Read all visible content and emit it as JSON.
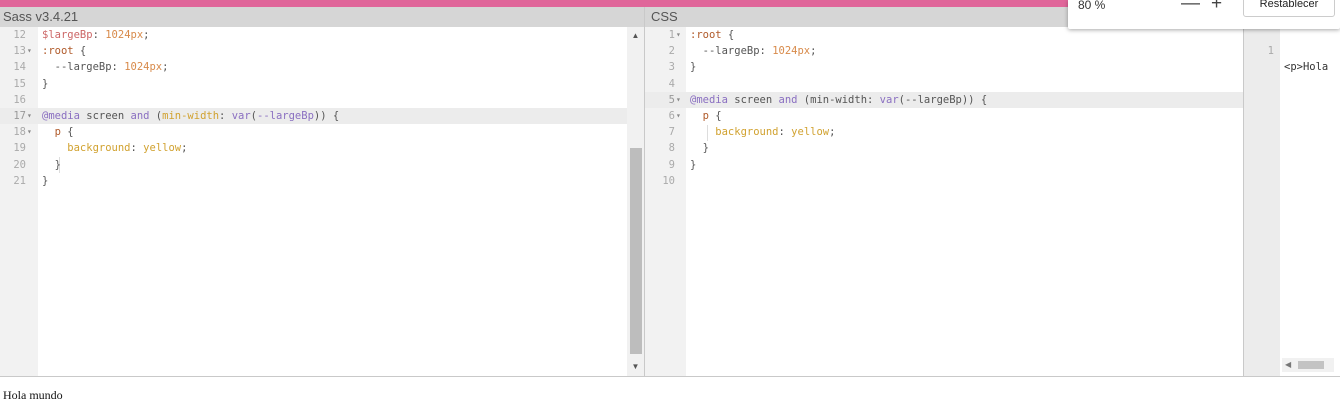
{
  "headers": {
    "sass": "Sass v3.4.21",
    "css": "CSS"
  },
  "sass_lines": [
    {
      "n": "12",
      "fold": false,
      "tokens": [
        [
          "t-var",
          "$largeBp"
        ],
        [
          "t-prop",
          ": "
        ],
        [
          "t-num",
          "1024px"
        ],
        [
          "t-prop",
          ";"
        ]
      ]
    },
    {
      "n": "13",
      "fold": true,
      "tokens": [
        [
          "t-sel",
          ":root"
        ],
        [
          "t-brace",
          " {"
        ]
      ]
    },
    {
      "n": "14",
      "fold": false,
      "tokens": [
        [
          "t-prop",
          "  --largeBp"
        ],
        [
          "t-prop",
          ": "
        ],
        [
          "t-num",
          "1024px"
        ],
        [
          "t-prop",
          ";"
        ]
      ]
    },
    {
      "n": "15",
      "fold": false,
      "tokens": [
        [
          "t-brace",
          "}"
        ]
      ]
    },
    {
      "n": "16",
      "fold": false,
      "tokens": []
    },
    {
      "n": "17",
      "fold": true,
      "active": true,
      "tokens": [
        [
          "t-kw",
          "@media"
        ],
        [
          "t-prop",
          " screen "
        ],
        [
          "t-kw",
          "and"
        ],
        [
          "t-prop",
          " ("
        ],
        [
          "t-val",
          "min-width"
        ],
        [
          "t-prop",
          ": "
        ],
        [
          "t-kw",
          "var"
        ],
        [
          "t-prop",
          "("
        ],
        [
          "t-kw",
          "--largeBp"
        ],
        [
          "t-prop",
          ")) {"
        ]
      ]
    },
    {
      "n": "18",
      "fold": true,
      "tokens": [
        [
          "t-sel",
          "  p"
        ],
        [
          "t-brace",
          " {"
        ]
      ]
    },
    {
      "n": "19",
      "fold": false,
      "tokens": [
        [
          "t-val",
          "    background"
        ],
        [
          "t-prop",
          ": "
        ],
        [
          "t-val",
          "yellow"
        ],
        [
          "t-prop",
          ";"
        ]
      ]
    },
    {
      "n": "20",
      "fold": false,
      "tokens": [
        [
          "t-brace",
          "  }"
        ]
      ]
    },
    {
      "n": "21",
      "fold": false,
      "tokens": [
        [
          "t-brace",
          "}"
        ]
      ]
    }
  ],
  "css_lines": [
    {
      "n": "1",
      "fold": true,
      "tokens": [
        [
          "t-sel",
          ":root"
        ],
        [
          "t-brace",
          " {"
        ]
      ]
    },
    {
      "n": "2",
      "fold": false,
      "tokens": [
        [
          "t-prop",
          "  --largeBp"
        ],
        [
          "t-prop",
          ": "
        ],
        [
          "t-num",
          "1024px"
        ],
        [
          "t-prop",
          ";"
        ]
      ]
    },
    {
      "n": "3",
      "fold": false,
      "tokens": [
        [
          "t-brace",
          "}"
        ]
      ]
    },
    {
      "n": "4",
      "fold": false,
      "tokens": []
    },
    {
      "n": "5",
      "fold": true,
      "active": true,
      "tokens": [
        [
          "t-kw",
          "@media"
        ],
        [
          "t-prop",
          " screen "
        ],
        [
          "t-kw",
          "and"
        ],
        [
          "t-prop",
          " (min-width: "
        ],
        [
          "t-kw",
          "var"
        ],
        [
          "t-prop",
          "(--largeBp)) {"
        ]
      ]
    },
    {
      "n": "6",
      "fold": true,
      "tokens": [
        [
          "t-sel",
          "  p"
        ],
        [
          "t-brace",
          " {"
        ]
      ]
    },
    {
      "n": "7",
      "fold": false,
      "tokens": [
        [
          "t-val",
          "    background"
        ],
        [
          "t-prop",
          ": "
        ],
        [
          "t-val",
          "yellow"
        ],
        [
          "t-prop",
          ";"
        ]
      ]
    },
    {
      "n": "8",
      "fold": false,
      "tokens": [
        [
          "t-brace",
          "  }"
        ]
      ]
    },
    {
      "n": "9",
      "fold": false,
      "tokens": [
        [
          "t-brace",
          "}"
        ]
      ]
    },
    {
      "n": "10",
      "fold": false,
      "tokens": []
    }
  ],
  "html_pane": {
    "line_number": "1",
    "code": "<p>Hola"
  },
  "output": {
    "text": "Hola mundo"
  },
  "zoom": {
    "level": "80 %",
    "minus": "—",
    "plus": "+",
    "reset_label": "Restablecer"
  },
  "icons": {
    "fold": "fold-arrow-icon",
    "scroll_up": "scroll-up-icon",
    "scroll_down": "scroll-down-icon"
  },
  "colors": {
    "accent_stripe": "#e0669a",
    "header_bg": "#d6d6d6",
    "active_line": "#ececec"
  }
}
